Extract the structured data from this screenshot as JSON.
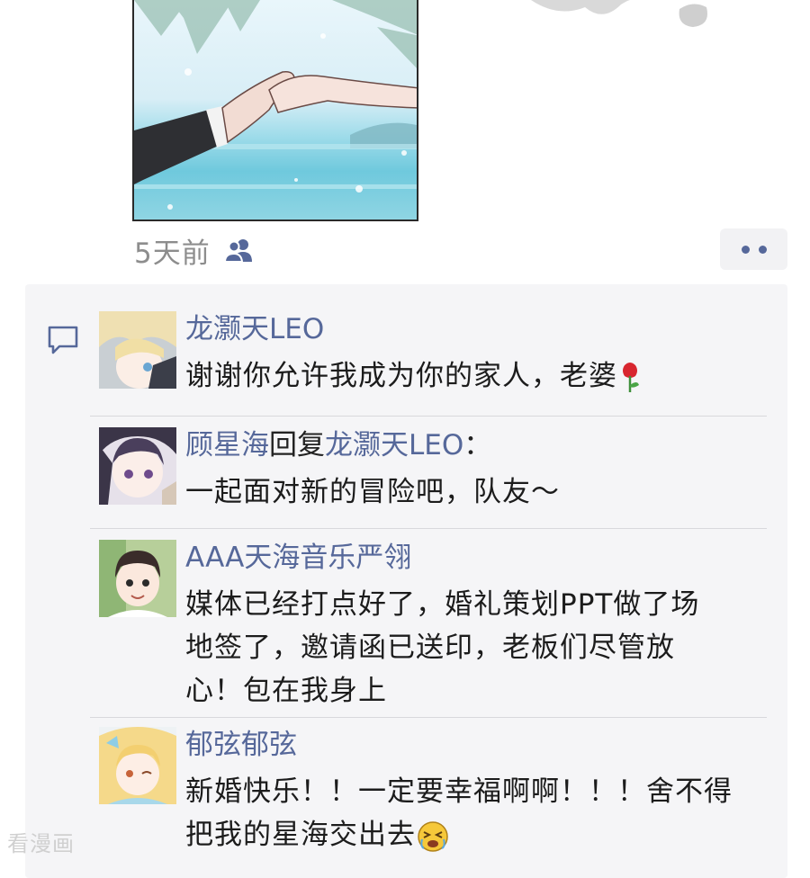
{
  "post": {
    "time": "5天前",
    "image_icon": "wedding-hands-photo",
    "visibility_icon": "friends-icon",
    "more_icon": "more-dots-icon"
  },
  "comments": [
    {
      "author": "龙灏天LEO",
      "text": "谢谢你允许我成为你的家人，老婆",
      "emoji": "rose-icon"
    },
    {
      "author": "顾星海",
      "reply_word": "回复",
      "reply_to": "龙灏天LEO",
      "colon": "：",
      "text": "一起面对新的冒险吧，队友～"
    },
    {
      "author": "AAA天海音乐严翎",
      "text_lines": [
        "媒体已经打点好了，婚礼策划PPT做了场",
        "地签了，邀请函已送印，老板们尽管放",
        "心！包在我身上"
      ]
    },
    {
      "author": "郁弦郁弦",
      "text_lines": [
        "新婚快乐！！一定要幸福啊啊！！！舍不得",
        "把我的星海交出去"
      ],
      "emoji": "crying-face-icon"
    }
  ],
  "watermark": "看漫画",
  "colors": {
    "name": "#56689a",
    "panel": "#f5f5f7",
    "text": "#1c1c1c",
    "meta": "#8d8d8d"
  }
}
